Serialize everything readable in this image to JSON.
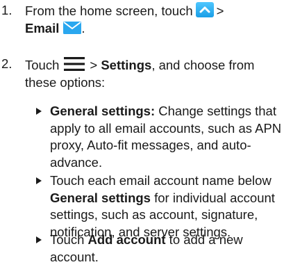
{
  "steps": [
    {
      "number": "1.",
      "text_a": "From the home screen, touch",
      "sep": ">",
      "bold_label": "Email",
      "end": "."
    },
    {
      "number": "2.",
      "text_a": "Touch",
      "sep_bold_prefix": "> ",
      "bold_label": "Settings",
      "text_b": ", and choose from these options:"
    }
  ],
  "bullets": [
    {
      "bold": "General settings:",
      "text": " Change settings that apply to all email accounts, such as APN proxy, Auto-fit messages, and auto-advance."
    },
    {
      "text_a": "Touch each email account name below ",
      "bold": "General settings",
      "text_b": " for individual account settings, such as account, signature, notification, and server settings."
    },
    {
      "text_a": "Touch ",
      "bold": "Add account",
      "text_b": " to add a new account."
    }
  ],
  "icons": {
    "apps": "chevron-up-icon",
    "email": "email-icon",
    "menu": "menu-icon"
  },
  "colors": {
    "icon_blue": "#2aa7ef"
  }
}
